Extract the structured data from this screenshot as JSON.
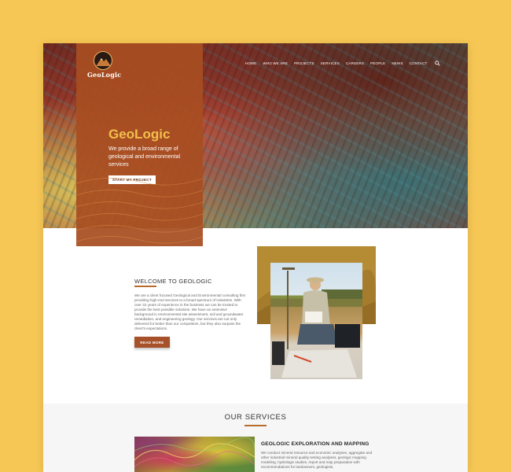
{
  "brand": {
    "logo_text": "GeoLogic",
    "accent": "#a84e21",
    "title_color": "#f2c04a"
  },
  "nav": {
    "items": [
      "HOME",
      "WHO WE ARE",
      "PROJECTS",
      "SERVICES",
      "CAREERS",
      "PEOPLE",
      "NEWS",
      "CONTACT"
    ],
    "search_icon": "search-icon"
  },
  "hero": {
    "title": "GeoLogic",
    "subtitle": "We provide a broad range of geological and environmental services",
    "cta": "START MY PROJECT"
  },
  "welcome": {
    "heading": "WELCOME TO GEOLOGIC",
    "body": "We are a client focused Geological and Environmental consulting firm providing high-end services to a broad spectrum of industries. With over 22 years of experience in the business we can be trusted to provide the best possible solutions. We have an extensive background in environmental site assessment, soil and groundwater remediation, and engineering geology. Our services are not only delivered for better than our competitors, but they also surpass the client's expectations.",
    "cta": "READ MORE"
  },
  "services": {
    "title": "OUR SERVICES",
    "item_heading": "GEOLOGIC EXPLORATION AND MAPPING",
    "item_body": "We conduct mineral resource and economic analyses, aggregate and other industrial mineral quality testing analyses, geologic mapping modeling, hydrologic studies, report and map preparation with recommendations for landowners, geologists,"
  }
}
